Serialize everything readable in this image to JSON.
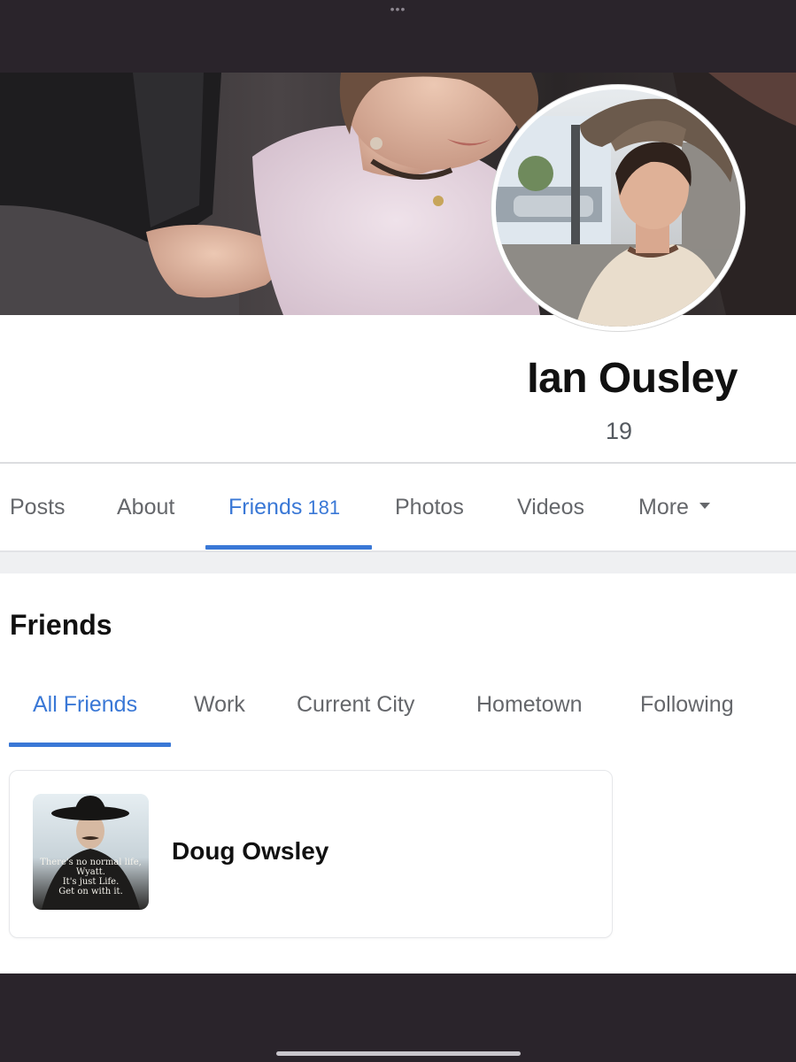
{
  "system": {
    "multitask_indicator": "•••"
  },
  "profile": {
    "name": "Ian Ousley",
    "age": "19"
  },
  "profile_tabs": [
    {
      "label": "Posts",
      "active": false
    },
    {
      "label": "About",
      "active": false
    },
    {
      "label": "Friends",
      "count": "181",
      "active": true
    },
    {
      "label": "Photos",
      "active": false
    },
    {
      "label": "Videos",
      "active": false
    },
    {
      "label": "More",
      "active": false,
      "icon": "caret-down-icon"
    }
  ],
  "friends_section": {
    "title": "Friends",
    "tabs": [
      {
        "label": "All Friends",
        "active": true
      },
      {
        "label": "Work",
        "active": false
      },
      {
        "label": "Current City",
        "active": false
      },
      {
        "label": "Hometown",
        "active": false
      },
      {
        "label": "Following",
        "active": false
      }
    ],
    "list": [
      {
        "name": "Doug Owsley",
        "thumbnail_caption": [
          "There's no normal life, Wyatt.",
          "It's just Life.",
          "Get on with it."
        ]
      }
    ]
  },
  "colors": {
    "accent": "#3a78d6",
    "tab_text": "#65676b",
    "device_frame": "#2a242b"
  }
}
